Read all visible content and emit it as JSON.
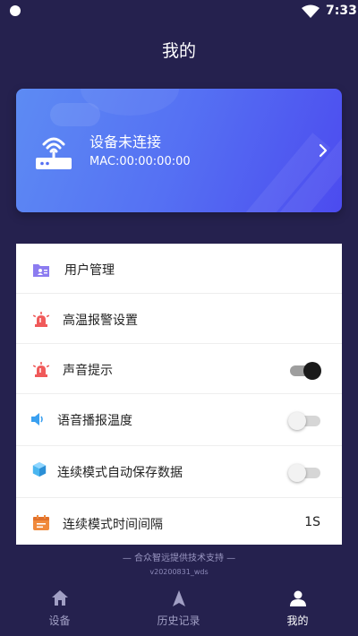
{
  "status_bar": {
    "time": "7:33"
  },
  "header": {
    "title": "我的"
  },
  "device_card": {
    "status": "设备未连接",
    "mac": "MAC:00:00:00:00"
  },
  "settings": {
    "user_management": {
      "label": "用户管理",
      "icon": "user-card-icon"
    },
    "high_temp_alarm": {
      "label": "高温报警设置",
      "icon": "alarm-light-icon"
    },
    "sound_prompt": {
      "label": "声音提示",
      "icon": "alarm-light-icon",
      "enabled": true
    },
    "voice_broadcast": {
      "label": "语音播报温度",
      "icon": "speaker-icon",
      "enabled": false
    },
    "auto_save": {
      "label": "连续模式自动保存数据",
      "icon": "cube-icon",
      "enabled": false
    },
    "interval": {
      "label": "连续模式时间间隔",
      "icon": "calendar-icon",
      "value": "1S"
    }
  },
  "footer": {
    "support": "— 合众智远提供技术支持 —",
    "version": "v20200831_wds"
  },
  "bottom_nav": {
    "items": [
      {
        "label": "设备",
        "icon": "home-icon",
        "active": false
      },
      {
        "label": "历史记录",
        "icon": "navigation-arrow-icon",
        "active": false
      },
      {
        "label": "我的",
        "icon": "person-icon",
        "active": true
      }
    ]
  },
  "colors": {
    "background": "#25214e",
    "card_start": "#5d8bf3",
    "card_end": "#4c4bef",
    "alarm_red": "#f05a5a",
    "speaker_blue": "#3aa0f0",
    "cube_blue": "#4ab6f0",
    "calendar_orange": "#f08a3c",
    "user_purple": "#8c7cf0",
    "nav_inactive": "#a19fc4"
  }
}
